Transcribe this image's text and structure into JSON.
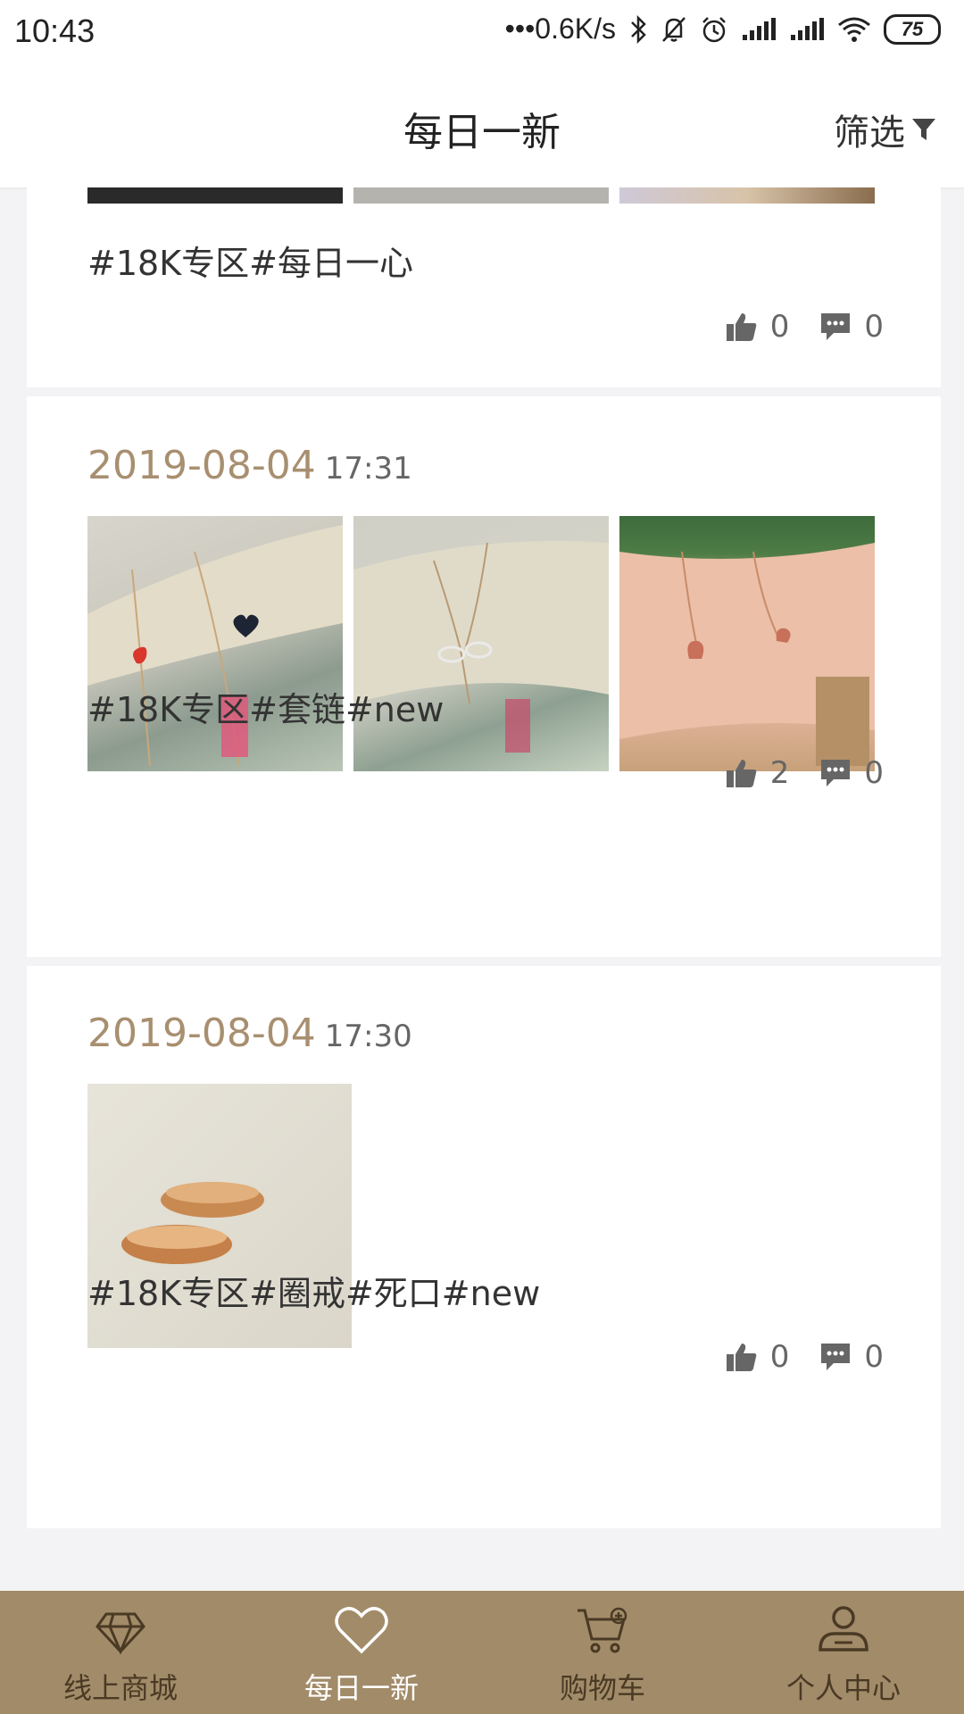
{
  "status_bar": {
    "time": "10:43",
    "network_speed": "0.6K/s",
    "battery": "75"
  },
  "header": {
    "title": "每日一新",
    "filter_label": "筛选"
  },
  "posts": [
    {
      "date": "",
      "time": "",
      "tags": "#18K专区#每日一心",
      "likes": "0",
      "comments": "0"
    },
    {
      "date": "2019-08-04",
      "time": "17:31",
      "tags": "#18K专区#套链#new",
      "likes": "2",
      "comments": "0"
    },
    {
      "date": "2019-08-04",
      "time": "17:30",
      "tags": "#18K专区#圈戒#死口#new",
      "likes": "0",
      "comments": "0"
    }
  ],
  "bottom_nav": [
    {
      "label": "线上商城",
      "icon": "diamond-icon"
    },
    {
      "label": "每日一新",
      "icon": "heart-icon",
      "active": true
    },
    {
      "label": "购物车",
      "icon": "cart-icon"
    },
    {
      "label": "个人中心",
      "icon": "person-icon"
    }
  ],
  "colors": {
    "accent": "#a28b69",
    "date": "#a88f70"
  }
}
